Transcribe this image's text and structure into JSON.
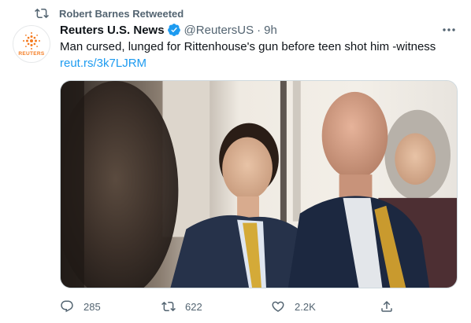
{
  "retweet_banner": {
    "text": "Robert Barnes Retweeted",
    "icon": "retweet-icon"
  },
  "author": {
    "name": "Reuters U.S. News",
    "handle": "@ReutersUS",
    "separator": "·",
    "time": "9h",
    "verified": true,
    "avatar_brand": "REUTERS",
    "brand_color": "#f47b20"
  },
  "tweet": {
    "text": "Man cursed, lunged for Rittenhouse's gun before teen shot him -witness",
    "link": "reut.rs/3k7LJRM"
  },
  "actions": {
    "reply_count": "285",
    "retweet_count": "622",
    "like_count": "2.2K"
  },
  "colors": {
    "link": "#1d9bf0",
    "secondary_text": "#536471",
    "verified": "#1d9bf0"
  }
}
